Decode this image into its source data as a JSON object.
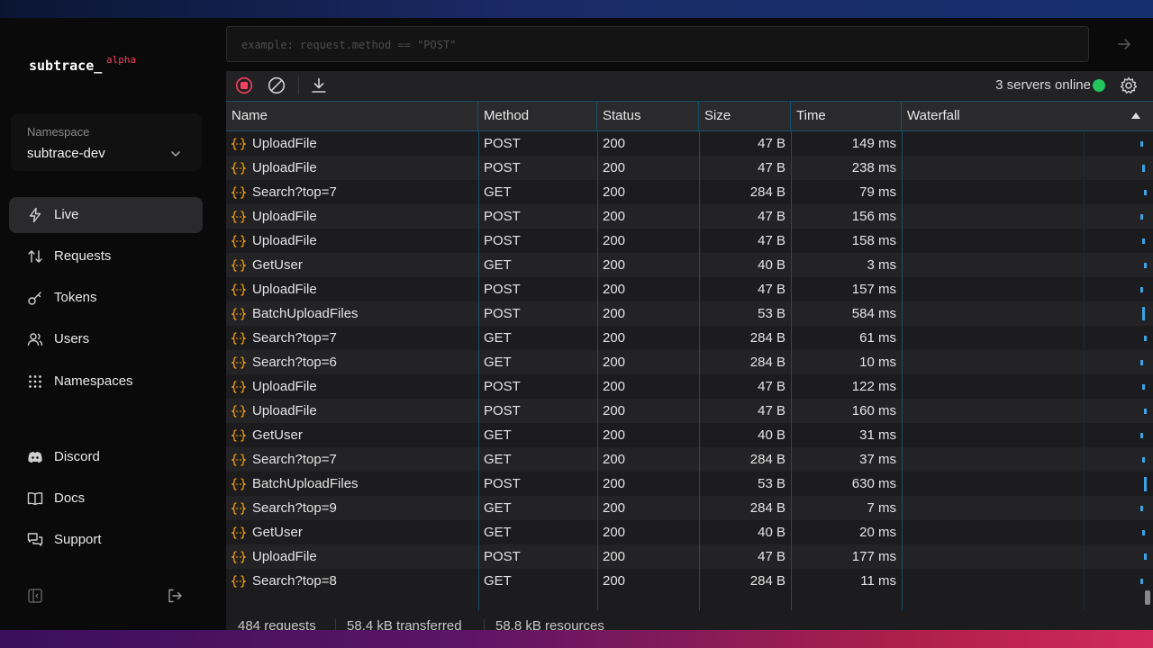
{
  "app": {
    "logo": "subtrace_",
    "logo_badge": "alpha"
  },
  "sidebar": {
    "namespace_label": "Namespace",
    "namespace_value": "subtrace-dev",
    "nav": [
      {
        "label": "Live",
        "icon": "bolt-icon",
        "active": true
      },
      {
        "label": "Requests",
        "icon": "arrows-up-down-icon"
      },
      {
        "label": "Tokens",
        "icon": "key-icon"
      },
      {
        "label": "Users",
        "icon": "users-icon"
      },
      {
        "label": "Namespaces",
        "icon": "grid-icon"
      }
    ],
    "links": [
      {
        "label": "Discord",
        "icon": "discord-icon"
      },
      {
        "label": "Docs",
        "icon": "book-icon"
      },
      {
        "label": "Support",
        "icon": "chat-icon"
      }
    ]
  },
  "search": {
    "placeholder": "example: request.method == \"POST\""
  },
  "toolbar": {
    "servers_status": "3 servers online",
    "status_color": "#22c55e"
  },
  "table": {
    "columns": [
      "Name",
      "Method",
      "Status",
      "Size",
      "Time",
      "Waterfall"
    ],
    "sort_column": "Waterfall",
    "sort_direction": "ascending",
    "rows": [
      {
        "name": "UploadFile",
        "method": "POST",
        "status": "200",
        "size": "47 B",
        "time": "149 ms",
        "ms": 149
      },
      {
        "name": "UploadFile",
        "method": "POST",
        "status": "200",
        "size": "47 B",
        "time": "238 ms",
        "ms": 238
      },
      {
        "name": "Search?top=7",
        "method": "GET",
        "status": "200",
        "size": "284 B",
        "time": "79 ms",
        "ms": 79
      },
      {
        "name": "UploadFile",
        "method": "POST",
        "status": "200",
        "size": "47 B",
        "time": "156 ms",
        "ms": 156
      },
      {
        "name": "UploadFile",
        "method": "POST",
        "status": "200",
        "size": "47 B",
        "time": "158 ms",
        "ms": 158
      },
      {
        "name": "GetUser",
        "method": "GET",
        "status": "200",
        "size": "40 B",
        "time": "3 ms",
        "ms": 3
      },
      {
        "name": "UploadFile",
        "method": "POST",
        "status": "200",
        "size": "47 B",
        "time": "157 ms",
        "ms": 157
      },
      {
        "name": "BatchUploadFiles",
        "method": "POST",
        "status": "200",
        "size": "53 B",
        "time": "584 ms",
        "ms": 584
      },
      {
        "name": "Search?top=7",
        "method": "GET",
        "status": "200",
        "size": "284 B",
        "time": "61 ms",
        "ms": 61
      },
      {
        "name": "Search?top=6",
        "method": "GET",
        "status": "200",
        "size": "284 B",
        "time": "10 ms",
        "ms": 10
      },
      {
        "name": "UploadFile",
        "method": "POST",
        "status": "200",
        "size": "47 B",
        "time": "122 ms",
        "ms": 122
      },
      {
        "name": "UploadFile",
        "method": "POST",
        "status": "200",
        "size": "47 B",
        "time": "160 ms",
        "ms": 160
      },
      {
        "name": "GetUser",
        "method": "GET",
        "status": "200",
        "size": "40 B",
        "time": "31 ms",
        "ms": 31
      },
      {
        "name": "Search?top=7",
        "method": "GET",
        "status": "200",
        "size": "284 B",
        "time": "37 ms",
        "ms": 37
      },
      {
        "name": "BatchUploadFiles",
        "method": "POST",
        "status": "200",
        "size": "53 B",
        "time": "630 ms",
        "ms": 630
      },
      {
        "name": "Search?top=9",
        "method": "GET",
        "status": "200",
        "size": "284 B",
        "time": "7 ms",
        "ms": 7
      },
      {
        "name": "GetUser",
        "method": "GET",
        "status": "200",
        "size": "40 B",
        "time": "20 ms",
        "ms": 20
      },
      {
        "name": "UploadFile",
        "method": "POST",
        "status": "200",
        "size": "47 B",
        "time": "177 ms",
        "ms": 177
      },
      {
        "name": "Search?top=8",
        "method": "GET",
        "status": "200",
        "size": "284 B",
        "time": "11 ms",
        "ms": 11
      }
    ]
  },
  "footer": {
    "requests": "484 requests",
    "transferred": "58.4 kB transferred",
    "resources": "58.8 kB resources"
  },
  "colors": {
    "accent": "#3ba3e6",
    "record": "#f43f5e",
    "rpc_icon": "#f59e0b"
  }
}
